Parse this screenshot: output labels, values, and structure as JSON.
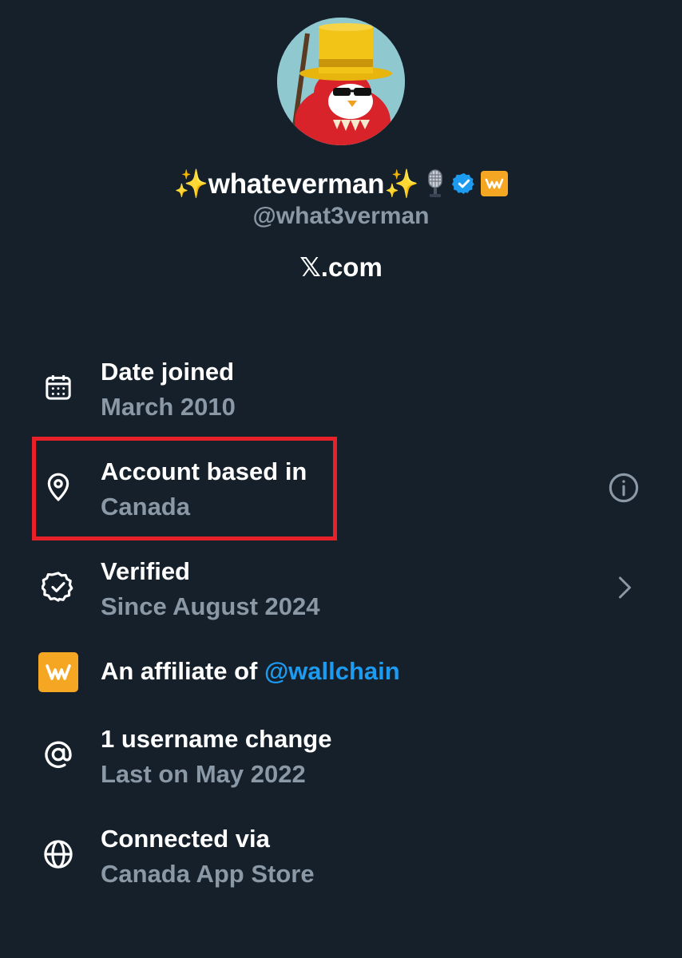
{
  "profile": {
    "display_name_prefix": "✨",
    "display_name": "whateverman",
    "display_name_suffix": "✨",
    "handle": "@what3verman",
    "website": "𝕏.com",
    "avatar_icon": "cartoon-bird-top-hat-avatar",
    "badges": [
      "microphone-emoji",
      "verified-badge-icon",
      "affiliate-badge-icon"
    ]
  },
  "about": {
    "date_joined": {
      "icon": "calendar-icon",
      "title": "Date joined",
      "subtitle": "March 2010"
    },
    "account_based": {
      "icon": "location-pin-icon",
      "title": "Account based in",
      "subtitle": "Canada",
      "right_icon": "info-icon"
    },
    "verified": {
      "icon": "verified-check-icon",
      "title": "Verified",
      "subtitle": "Since August 2024",
      "right_icon": "chevron-right-icon"
    },
    "affiliate": {
      "icon": "wallchain-logo-icon",
      "title_prefix": "An affiliate of ",
      "title_link": "@wallchain"
    },
    "username_change": {
      "icon": "at-sign-icon",
      "title": "1 username change",
      "subtitle": "Last on May 2022"
    },
    "connected_via": {
      "icon": "globe-icon",
      "title": "Connected via",
      "subtitle": "Canada App Store"
    }
  },
  "colors": {
    "background": "#15202b",
    "primary_text": "#ffffff",
    "secondary_text": "#8b98a5",
    "link": "#1d9bf0",
    "highlight": "#e8202a",
    "affiliate_badge": "#f5a623"
  }
}
